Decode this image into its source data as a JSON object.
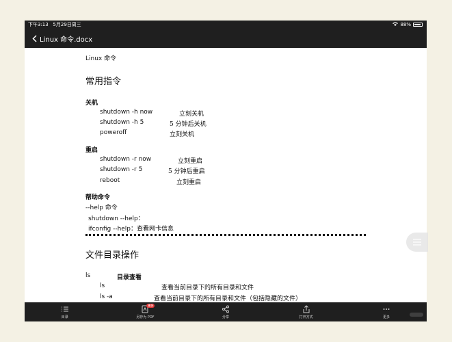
{
  "status_bar": {
    "time": "下午3:13",
    "date": "5月29日周三",
    "battery": "88%"
  },
  "nav": {
    "title": "Linux 命令.docx"
  },
  "document": {
    "heading_top": "Linux 命令",
    "section1": "常用指令",
    "shutdown_head": "关机",
    "shutdown_rows": [
      {
        "cmd": "shutdown -h now",
        "desc": "立刻关机"
      },
      {
        "cmd": "shutdown -h 5",
        "desc": "5 分钟后关机"
      },
      {
        "cmd": "poweroff",
        "desc": "立刻关机"
      }
    ],
    "reboot_head": "重启",
    "reboot_rows": [
      {
        "cmd": "shutdown -r now",
        "desc": "立刻重启"
      },
      {
        "cmd": "shutdown -r 5",
        "desc": "5 分钟后重启"
      },
      {
        "cmd": "reboot",
        "desc": "立刻重启"
      }
    ],
    "help_head": "帮助命令",
    "help_lines": [
      "--help 命令",
      "shutdown --help：",
      "ifconfig --help：查看网卡信息"
    ],
    "section2": "文件目录操作",
    "ls_label": "ls",
    "ls_title": "目录查看",
    "ls_rows": [
      {
        "cmd": "ls",
        "desc": "查看当前目录下的所有目录和文件"
      },
      {
        "cmd": "ls -a",
        "desc": "查看当前目录下的所有目录和文件（包括隐藏的文件）"
      }
    ]
  },
  "toolbar": {
    "items": [
      {
        "label": "目录",
        "icon": "list-icon"
      },
      {
        "label": "另存为 PDF",
        "icon": "pdf-icon",
        "badge": "更多"
      },
      {
        "label": "分享",
        "icon": "share-icon"
      },
      {
        "label": "打开方式",
        "icon": "open-with-icon"
      },
      {
        "label": "更多",
        "icon": "more-icon"
      }
    ]
  }
}
